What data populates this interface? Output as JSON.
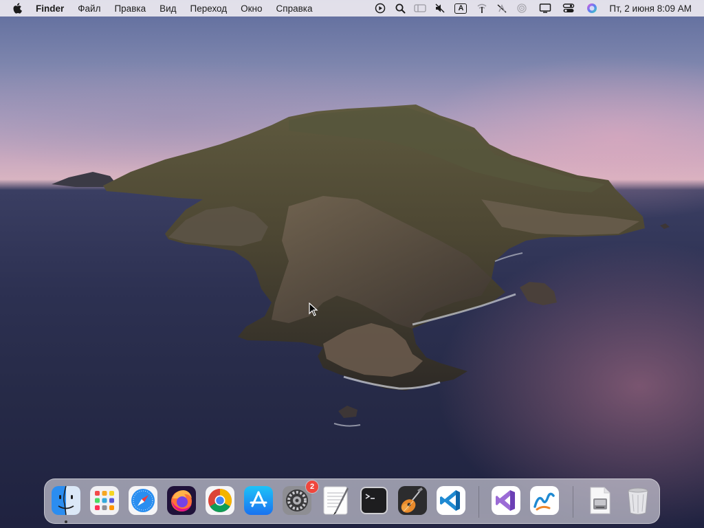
{
  "menubar": {
    "app_name": "Finder",
    "menus": [
      "Файл",
      "Правка",
      "Вид",
      "Переход",
      "Окно",
      "Справка"
    ],
    "input_source": "A",
    "clock": "Пт, 2 июня  8:09 AM",
    "status_icons": [
      "play-circle-icon",
      "search-icon",
      "window-tile-icon",
      "mute-icon",
      "input-source-icon",
      "wifi-off-icon",
      "antenna-off-icon",
      "airplay-icon",
      "display-icon",
      "control-center-icon",
      "siri-icon"
    ]
  },
  "dock": {
    "items": [
      {
        "name": "finder",
        "running": true
      },
      {
        "name": "launchpad"
      },
      {
        "name": "safari"
      },
      {
        "name": "firefox"
      },
      {
        "name": "chrome"
      },
      {
        "name": "app-store"
      },
      {
        "name": "system-preferences",
        "badge": "2"
      },
      {
        "name": "textedit"
      },
      {
        "name": "terminal"
      },
      {
        "name": "garageband"
      },
      {
        "name": "visual-studio-code"
      },
      {
        "name": "visual-studio"
      },
      {
        "name": "freeform"
      },
      {
        "name": "disk-image"
      },
      {
        "name": "trash"
      }
    ]
  },
  "colors": {
    "menubar_bg": "#ece8f0",
    "badge_red": "#f0463c",
    "dock_bg": "#e1dee8"
  }
}
